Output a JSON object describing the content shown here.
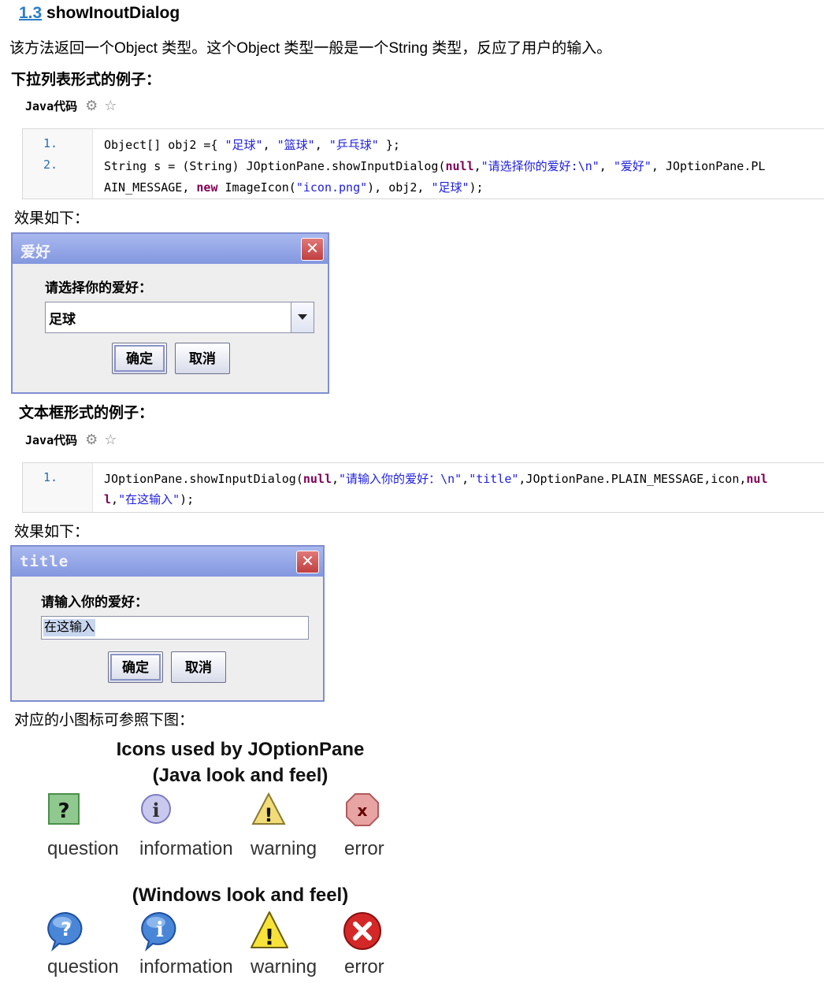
{
  "heading": {
    "number": "1.3",
    "title": "showInoutDialog"
  },
  "intro": "该方法返回一个Object 类型。这个Object 类型一般是一个String 类型，反应了用户的输入。",
  "example1": {
    "title": "下拉列表形式的例子：",
    "code_label": "Java代码",
    "line_numbers": [
      "1.",
      "2."
    ],
    "result_label": "效果如下：",
    "dialog": {
      "title": "爱好",
      "prompt": "请选择你的爱好：",
      "selected": "足球",
      "ok": "确定",
      "cancel": "取消"
    }
  },
  "example2": {
    "title": "文本框形式的例子：",
    "code_label": "Java代码",
    "line_numbers": [
      "1."
    ],
    "result_label": "效果如下：",
    "dialog": {
      "title": "title",
      "prompt": "请输入你的爱好：",
      "input_value": "在这输入",
      "ok": "确定",
      "cancel": "取消"
    }
  },
  "icons_note": "对应的小图标可参照下图：",
  "icons_figure": {
    "title_line1": "Icons used by JOptionPane",
    "java_title": "(Java look and feel)",
    "windows_title": "(Windows look and feel)",
    "labels": [
      "question",
      "information",
      "warning",
      "error"
    ]
  },
  "colors": {
    "link": "#2a7ec8",
    "string": "#2020e0",
    "keyword": "#7f0055",
    "line_number": "#2b6ea8"
  }
}
